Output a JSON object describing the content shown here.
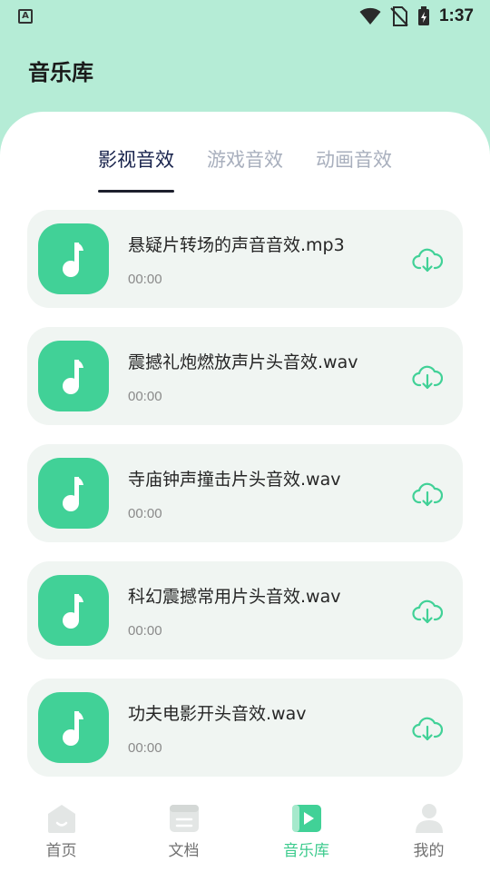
{
  "status_bar": {
    "time": "1:37",
    "app_letter": "A"
  },
  "header": {
    "title": "音乐库"
  },
  "tabs": [
    {
      "label": "影视音效",
      "active": true
    },
    {
      "label": "游戏音效",
      "active": false
    },
    {
      "label": "动画音效",
      "active": false
    }
  ],
  "tracks": [
    {
      "title": "悬疑片转场的声音音效.mp3",
      "duration": "00:00"
    },
    {
      "title": "震撼礼炮燃放声片头音效.wav",
      "duration": "00:00"
    },
    {
      "title": "寺庙钟声撞击片头音效.wav",
      "duration": "00:00"
    },
    {
      "title": "科幻震撼常用片头音效.wav",
      "duration": "00:00"
    },
    {
      "title": "功夫电影开头音效.wav",
      "duration": "00:00"
    }
  ],
  "bottom_nav": [
    {
      "label": "首页",
      "icon": "home-icon",
      "active": false
    },
    {
      "label": "文档",
      "icon": "document-icon",
      "active": false
    },
    {
      "label": "音乐库",
      "icon": "play-icon",
      "active": true
    },
    {
      "label": "我的",
      "icon": "profile-icon",
      "active": false
    }
  ],
  "colors": {
    "header_bg": "#b5ecd6",
    "accent": "#41d197",
    "active_tab": "#17224b",
    "inactive_tab": "#a8afbd",
    "card_bg": "#f0f5f2"
  }
}
